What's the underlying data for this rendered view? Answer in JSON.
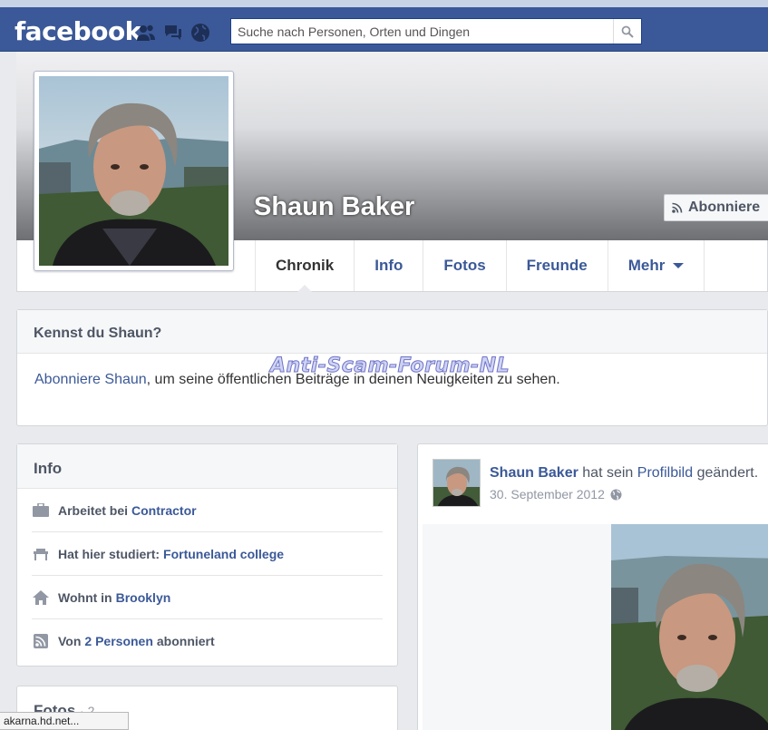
{
  "header": {
    "logo": "facebook",
    "search_placeholder": "Suche nach Personen, Orten und Dingen",
    "jewels": [
      "friend-requests-icon",
      "messages-icon",
      "notifications-globe-icon"
    ]
  },
  "profile": {
    "name": "Shaun Baker",
    "subscribe_label": "Abonniere"
  },
  "tabs": [
    {
      "label": "Chronik",
      "active": true
    },
    {
      "label": "Info"
    },
    {
      "label": "Fotos"
    },
    {
      "label": "Freunde"
    },
    {
      "label": "Mehr"
    }
  ],
  "know_card": {
    "title": "Kennst du Shaun?",
    "link_text": "Abonniere Shaun",
    "rest_text": ", um seine öffentlichen Beiträge in deinen Neuigkeiten zu sehen."
  },
  "watermark": "Anti-Scam-Forum-NL",
  "info_card": {
    "title": "Info",
    "rows": [
      {
        "icon": "briefcase-icon",
        "text": "Arbeitet bei",
        "link": "Contractor"
      },
      {
        "icon": "school-icon",
        "text": "Hat hier studiert:",
        "link": "Fortuneland college"
      },
      {
        "icon": "home-icon",
        "text": "Wohnt in",
        "link": "Brooklyn"
      },
      {
        "icon": "rss-icon",
        "text": "Von",
        "link": "2 Personen",
        "suffix": "abonniert"
      }
    ]
  },
  "fotos_card": {
    "title": "Fotos",
    "count": "· 2"
  },
  "statusbar": {
    "text": "akarna.hd.net..."
  },
  "post": {
    "author": "Shaun Baker",
    "action_pre": "hat sein",
    "action_link": "Profilbild",
    "action_post": "geändert.",
    "date": "30. September 2012"
  },
  "colors": {
    "brand_blue": "#3b5998",
    "link_blue": "#3b5998",
    "page_bg": "#e9eaed"
  }
}
